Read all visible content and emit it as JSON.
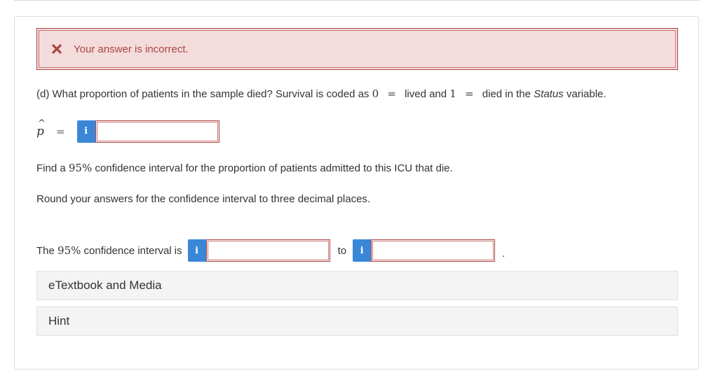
{
  "alert": {
    "icon": "close-x-icon",
    "message": "Your answer is incorrect.",
    "color": "#a94442",
    "background": "#f4dcdc"
  },
  "question_d": {
    "prefix": "(d) What proportion of patients in the sample died? Survival is coded as",
    "zero": "0",
    "eq1": "=",
    "mid": "lived and",
    "one": "1",
    "eq2": "=",
    "suffix_pre": "died in the",
    "status_word": "Status",
    "suffix_post": "variable."
  },
  "phat": {
    "symbol": "p",
    "hat": "^",
    "equals": "=",
    "info_icon": "i",
    "value": ""
  },
  "instructions": {
    "find_pre": "Find a",
    "find_pct": "95%",
    "find_post": "confidence interval for the proportion of patients admitted to this ICU that die.",
    "round": "Round your answers for the confidence interval to three decimal places."
  },
  "ci": {
    "label_pre": "The",
    "label_pct": "95%",
    "label_post": "confidence interval is",
    "info_icon": "i",
    "lower_value": "",
    "to": "to",
    "upper_value": "",
    "period": "."
  },
  "panels": {
    "etextbook": "eTextbook and Media",
    "hint": "Hint"
  },
  "colors": {
    "info_button": "#3a87d8",
    "error_border": "#a94442"
  }
}
